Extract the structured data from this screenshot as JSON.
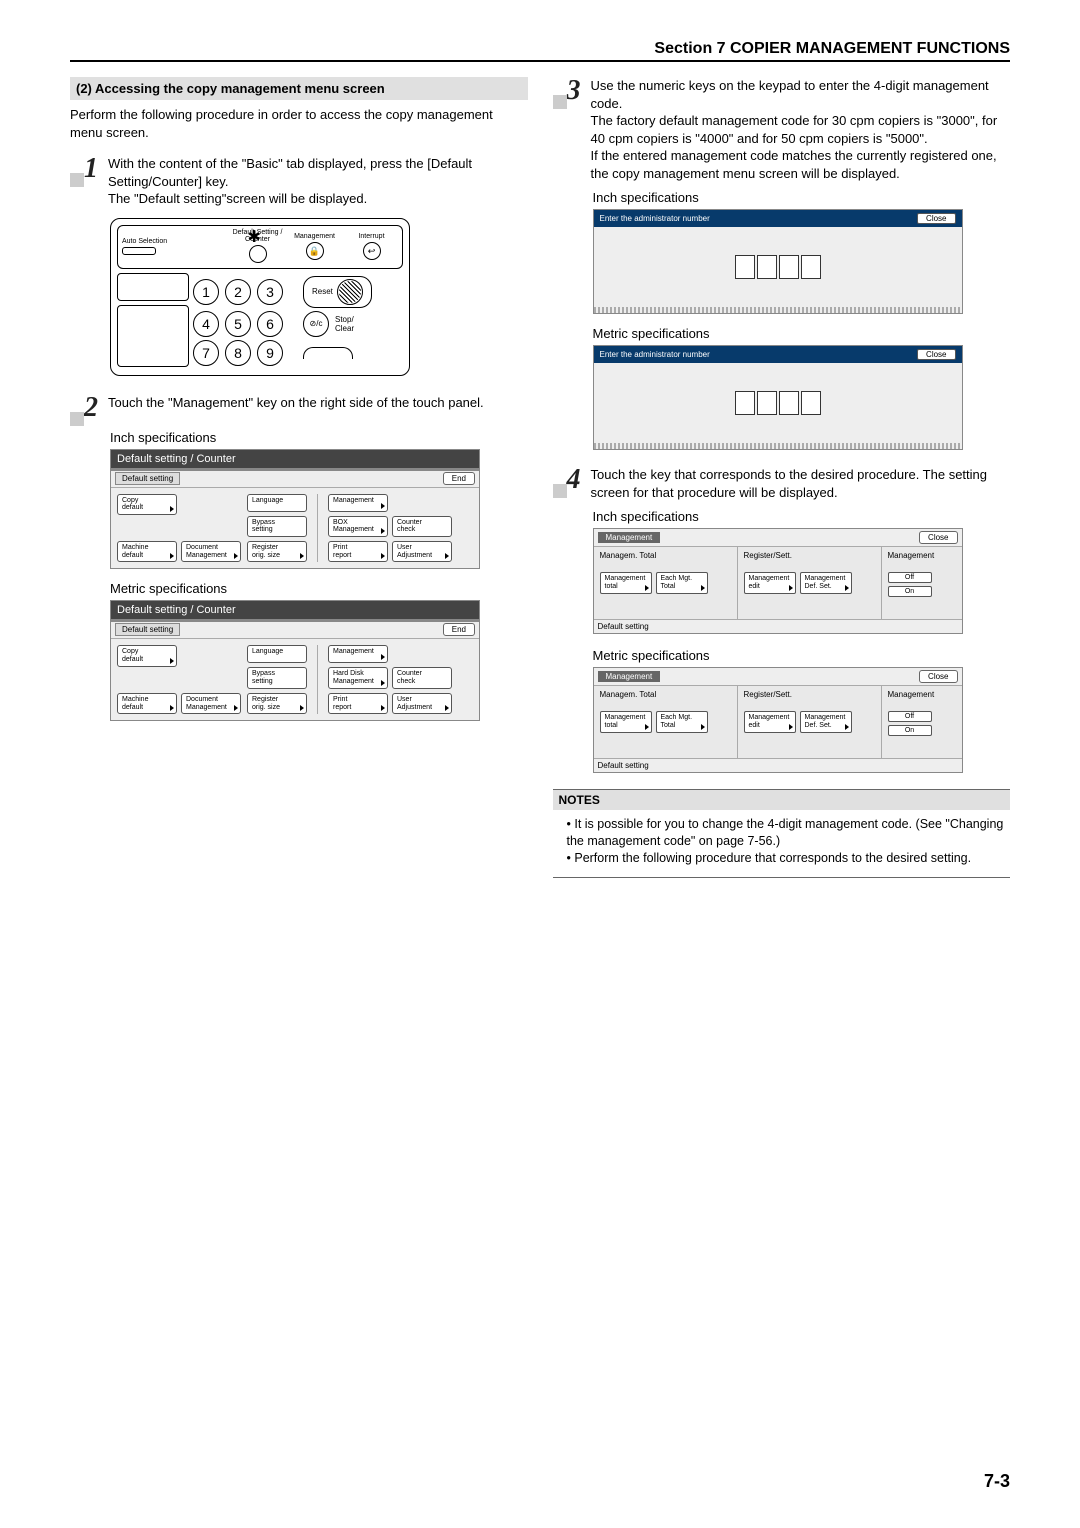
{
  "header": {
    "section_title": "Section 7  COPIER MANAGEMENT FUNCTIONS"
  },
  "left": {
    "subsection": "(2)  Accessing the copy management menu screen",
    "intro": "Perform the following procedure in order to access the copy management menu screen.",
    "step1": {
      "line1": "With the content of the \"Basic\" tab displayed, press the [Default Setting/Counter] key.",
      "line2": "The \"Default setting\"screen will be displayed."
    },
    "keypad": {
      "auto_selection": "Auto Selection",
      "default_setting": "Default Setting /",
      "counter": "Counter",
      "management": "Management",
      "interrupt": "Interrupt",
      "reset": "Reset",
      "stop_clear": "Stop/\nClear",
      "keys": [
        "1",
        "2",
        "3",
        "4",
        "5",
        "6",
        "7",
        "8",
        "9"
      ]
    },
    "step2": "Touch the \"Management\" key on the right side of the touch panel.",
    "inch_label": "Inch specifications",
    "metric_label": "Metric specifications",
    "panel": {
      "title": "Default setting / Counter",
      "tab": "Default setting",
      "end": "End",
      "btns_left": [
        "Copy\ndefault",
        "Machine\ndefault",
        "Document\nManagement"
      ],
      "btns_mid": [
        "Language",
        "Bypass\nsetting",
        "Register\norig. size"
      ],
      "btns_right_top": "Management",
      "btns_right_a": "BOX\nManagement",
      "btns_right_a2": "Hard Disk\nManagement",
      "btns_right_b": "Counter\ncheck",
      "btns_right_c": "Print\nreport",
      "btns_right_d": "User\nAdjustment"
    }
  },
  "right": {
    "step3": {
      "p1": "Use the numeric keys on the keypad to enter the 4-digit management code.",
      "p2": "The factory default management code for 30 cpm copiers is \"3000\", for 40 cpm copiers is \"4000\" and for 50 cpm copiers is \"5000\".",
      "p3": "If the entered management code matches the currently registered one, the copy management menu screen will be displayed."
    },
    "inch_label": "Inch specifications",
    "metric_label": "Metric specifications",
    "admin": {
      "prompt": "Enter the administrator number",
      "close": "Close"
    },
    "step4": {
      "p1": "Touch the key that corresponds to the desired procedure. The setting screen for that procedure will be displayed."
    },
    "mgmt": {
      "tab": "Management",
      "close": "Close",
      "col1_title": "Managem. Total",
      "col2_title": "Register/Sett.",
      "col3_title": "Management",
      "b1": "Management\ntotal",
      "b2": "Each Mgt.\nTotal",
      "b3": "Management\nedit",
      "b4": "Management\nDef. Set.",
      "off": "Off",
      "on": "On",
      "footer": "Default setting"
    },
    "notes": {
      "title": "NOTES",
      "n1": "It is possible for you to change the 4-digit management code. (See \"Changing the management code\" on page 7-56.)",
      "n2": "Perform the following procedure that corresponds to the desired setting."
    }
  },
  "page_number": "7-3"
}
